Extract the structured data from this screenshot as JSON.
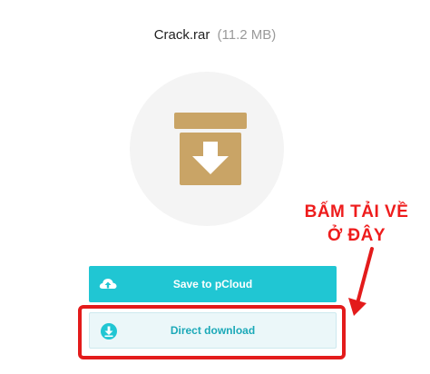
{
  "file": {
    "name": "Crack.rar",
    "size": "(11.2 MB)"
  },
  "icons": {
    "file_type": "archive-box-download-icon",
    "save": "cloud-upload-icon",
    "direct": "download-icon"
  },
  "buttons": {
    "save_label": "Save to pCloud",
    "direct_label": "Direct download"
  },
  "annotation": {
    "line1": "BẤM TẢI VỀ",
    "line2": "Ở ĐÂY"
  },
  "colors": {
    "accent": "#20c6d3",
    "archive_icon": "#c9a466",
    "annotation": "#e31b1b"
  }
}
